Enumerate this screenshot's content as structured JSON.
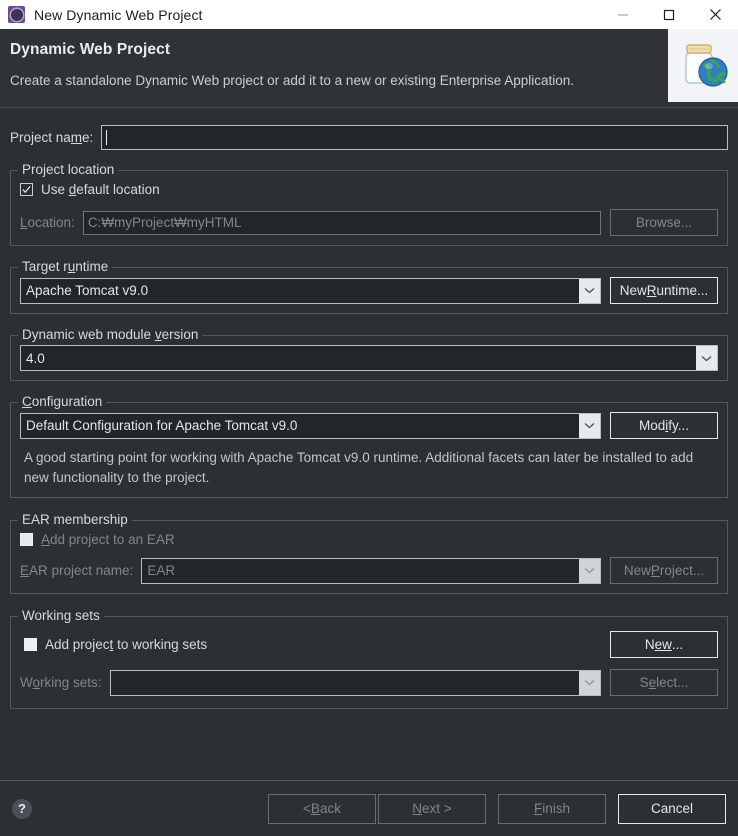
{
  "window": {
    "title": "New Dynamic Web Project",
    "icon": "eclipse-project-icon",
    "minimize_label": "—",
    "maximize_label": "□",
    "close_label": "✕"
  },
  "banner": {
    "title": "Dynamic Web Project",
    "description": "Create a standalone Dynamic Web project or add it to a new or existing Enterprise Application.",
    "icon": "jar-globe-icon"
  },
  "project_name": {
    "label": "Project name:",
    "value": "",
    "placeholder": ""
  },
  "project_location": {
    "legend": "Project location",
    "use_default_label": "Use default location",
    "use_default_checked": true,
    "location_label": "Location:",
    "location_value": "C:₩myProject₩myHTML",
    "browse_label": "Browse..."
  },
  "target_runtime": {
    "legend": "Target runtime",
    "selected": "Apache Tomcat v9.0",
    "new_runtime_label": "New Runtime..."
  },
  "module_version": {
    "legend": "Dynamic web module version",
    "selected": "4.0"
  },
  "configuration": {
    "legend": "Configuration",
    "selected": "Default Configuration for Apache Tomcat v9.0",
    "modify_label": "Modify...",
    "description": "A good starting point for working with Apache Tomcat v9.0 runtime. Additional facets can later be installed to add new functionality to the project."
  },
  "ear_membership": {
    "legend": "EAR membership",
    "add_to_ear_label": "Add project to an EAR",
    "add_to_ear_checked": false,
    "ear_project_label": "EAR project name:",
    "ear_project_value": "EAR",
    "new_project_label": "New Project..."
  },
  "working_sets": {
    "legend": "Working sets",
    "add_to_working_sets_label": "Add project to working sets",
    "add_to_working_sets_checked": false,
    "working_sets_label": "Working sets:",
    "working_sets_value": "",
    "new_label": "New...",
    "select_label": "Select..."
  },
  "footer": {
    "help_label": "?",
    "back_label": "< Back",
    "next_label": "Next >",
    "finish_label": "Finish",
    "cancel_label": "Cancel"
  },
  "colors": {
    "dialog_bg": "#2b3034",
    "banner_bg": "#2f3337",
    "titlebar_bg": "#ffffff",
    "text": "#d6dade",
    "disabled_text": "#7f878d",
    "border": "#b7bdc2"
  }
}
